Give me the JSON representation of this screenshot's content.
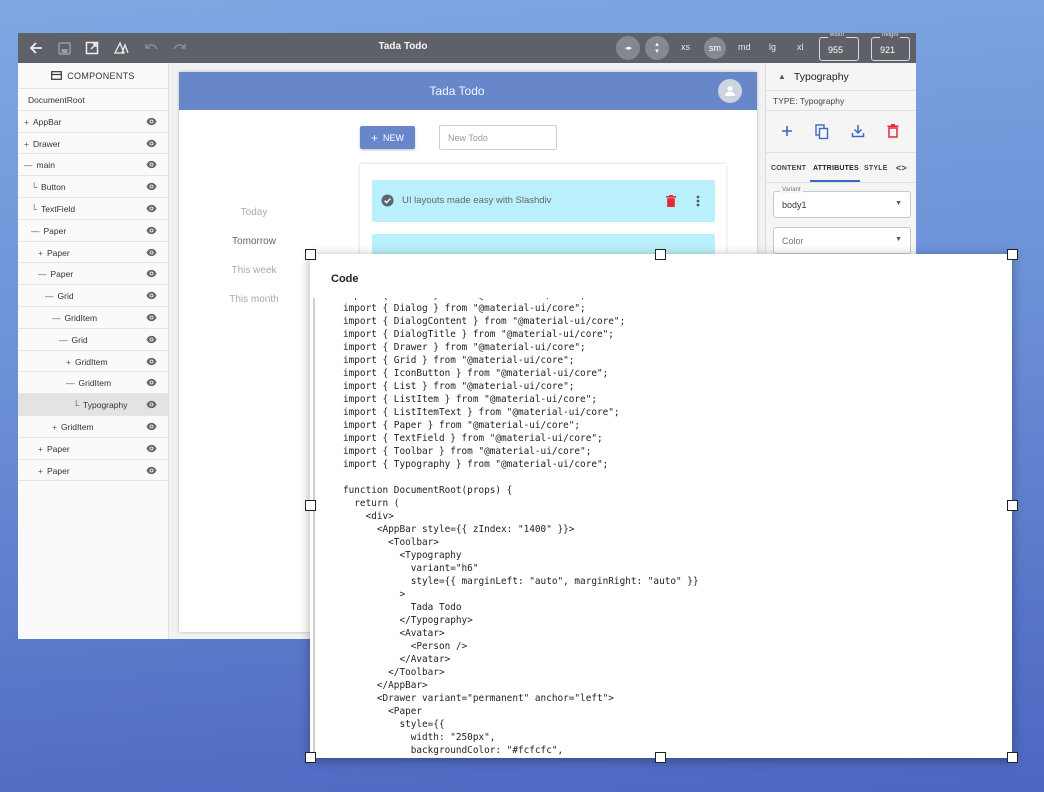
{
  "toolbar": {
    "title": "Tada Todo",
    "breakpoints": [
      "xs",
      "sm",
      "md",
      "lg",
      "xl"
    ],
    "selected_breakpoint": "sm",
    "width_label": "width",
    "width_value": "955",
    "height_label": "height",
    "height_value": "921",
    "icons": [
      "back-arrow-icon",
      "save-icon",
      "open-external-icon",
      "theme-icon",
      "undo-icon",
      "redo-icon",
      "fit-width-icon",
      "fit-height-icon"
    ]
  },
  "components_panel": {
    "header": "COMPONENTS",
    "items": [
      {
        "label": "DocumentRoot",
        "prefix": "",
        "indent": 0,
        "eye": false
      },
      {
        "label": "AppBar",
        "prefix": "+",
        "indent": 0,
        "eye": true
      },
      {
        "label": "Drawer",
        "prefix": "+",
        "indent": 0,
        "eye": true
      },
      {
        "label": "main",
        "prefix": "—",
        "indent": 0,
        "eye": true
      },
      {
        "label": "Button",
        "prefix": "└",
        "indent": 1,
        "eye": true
      },
      {
        "label": "TextField",
        "prefix": "└",
        "indent": 1,
        "eye": true
      },
      {
        "label": "Paper",
        "prefix": "—",
        "indent": 1,
        "eye": true
      },
      {
        "label": "Paper",
        "prefix": "+",
        "indent": 2,
        "eye": true
      },
      {
        "label": "Paper",
        "prefix": "—",
        "indent": 2,
        "eye": true
      },
      {
        "label": "Grid",
        "prefix": "—",
        "indent": 3,
        "eye": true
      },
      {
        "label": "GridItem",
        "prefix": "—",
        "indent": 4,
        "eye": true
      },
      {
        "label": "Grid",
        "prefix": "—",
        "indent": 5,
        "eye": true
      },
      {
        "label": "GridItem",
        "prefix": "+",
        "indent": 6,
        "eye": true
      },
      {
        "label": "GridItem",
        "prefix": "—",
        "indent": 6,
        "eye": true
      },
      {
        "label": "Typography",
        "prefix": "└",
        "indent": 7,
        "eye": true,
        "selected": true
      },
      {
        "label": "GridItem",
        "prefix": "+",
        "indent": 4,
        "eye": true
      },
      {
        "label": "Paper",
        "prefix": "+",
        "indent": 2,
        "eye": true
      },
      {
        "label": "Paper",
        "prefix": "+",
        "indent": 2,
        "eye": true
      }
    ]
  },
  "preview": {
    "appbar_title": "Tada Todo",
    "drawer_items": [
      "Today",
      "Tomorrow",
      "This week",
      "This month"
    ],
    "new_button": "NEW",
    "new_todo_placeholder": "New Todo",
    "todo_text": "UI layouts made easy with Slashdiv"
  },
  "properties_panel": {
    "title": "Typography",
    "type_label": "TYPE: Typography",
    "tabs": [
      "CONTENT",
      "ATTRIBUTES",
      "STYLE",
      "<>"
    ],
    "active_tab": "ATTRIBUTES",
    "variant_label": "Variant",
    "variant_value": "body1",
    "color_placeholder": "Color"
  },
  "code_dialog": {
    "title": "Code",
    "lines": [
      "import { Button } from \"@material-ui/core\";",
      "import { Dialog } from \"@material-ui/core\";",
      "import { DialogContent } from \"@material-ui/core\";",
      "import { DialogTitle } from \"@material-ui/core\";",
      "import { Drawer } from \"@material-ui/core\";",
      "import { Grid } from \"@material-ui/core\";",
      "import { IconButton } from \"@material-ui/core\";",
      "import { List } from \"@material-ui/core\";",
      "import { ListItem } from \"@material-ui/core\";",
      "import { ListItemText } from \"@material-ui/core\";",
      "import { Paper } from \"@material-ui/core\";",
      "import { TextField } from \"@material-ui/core\";",
      "import { Toolbar } from \"@material-ui/core\";",
      "import { Typography } from \"@material-ui/core\";",
      "",
      "function DocumentRoot(props) {",
      "  return (",
      "    <div>",
      "      <AppBar style={{ zIndex: \"1400\" }}>",
      "        <Toolbar>",
      "          <Typography",
      "            variant=\"h6\"",
      "            style={{ marginLeft: \"auto\", marginRight: \"auto\" }}",
      "          >",
      "            Tada Todo",
      "          </Typography>",
      "          <Avatar>",
      "            <Person />",
      "          </Avatar>",
      "        </Toolbar>",
      "      </AppBar>",
      "      <Drawer variant=\"permanent\" anchor=\"left\">",
      "        <Paper",
      "          style={{",
      "            width: \"250px\",",
      "            backgroundColor: \"#fcfcfc\","
    ]
  },
  "colors": {
    "appbar": "#6887cb",
    "todo_bg": "#b9f0fb",
    "delete_red": "#e8273c",
    "toolbar": "#5e6268"
  }
}
